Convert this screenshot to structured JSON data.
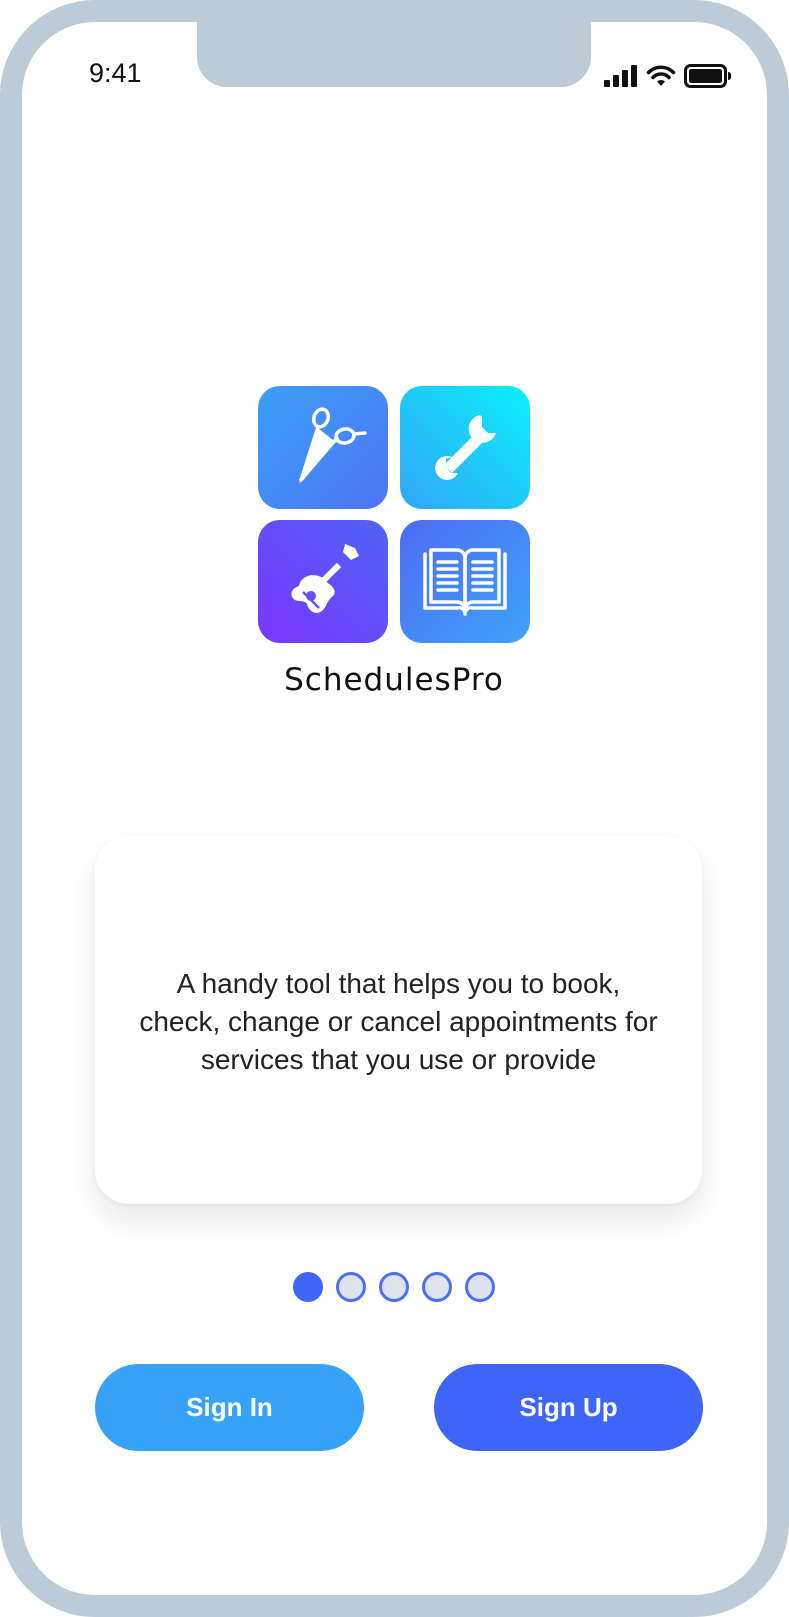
{
  "status_bar": {
    "time": "9:41",
    "icons": [
      "cellular-signal-icon",
      "wifi-icon",
      "battery-icon"
    ]
  },
  "logo": {
    "tiles": [
      "scissors-icon",
      "wrench-icon",
      "guitar-icon",
      "book-icon"
    ],
    "brand_name": "SchedulesPro"
  },
  "intro_card": {
    "text": "A handy tool that helps you to book, check, change or cancel appointments for services that you use or provide"
  },
  "pagination": {
    "total": 5,
    "current": 1
  },
  "actions": {
    "sign_in_label": "Sign In",
    "sign_up_label": "Sign Up"
  },
  "colors": {
    "frame": "#bccbd5",
    "accent_light_blue": "#36a3f8",
    "accent_blue": "#3f64f8",
    "active_dot": "#3f66f5"
  }
}
